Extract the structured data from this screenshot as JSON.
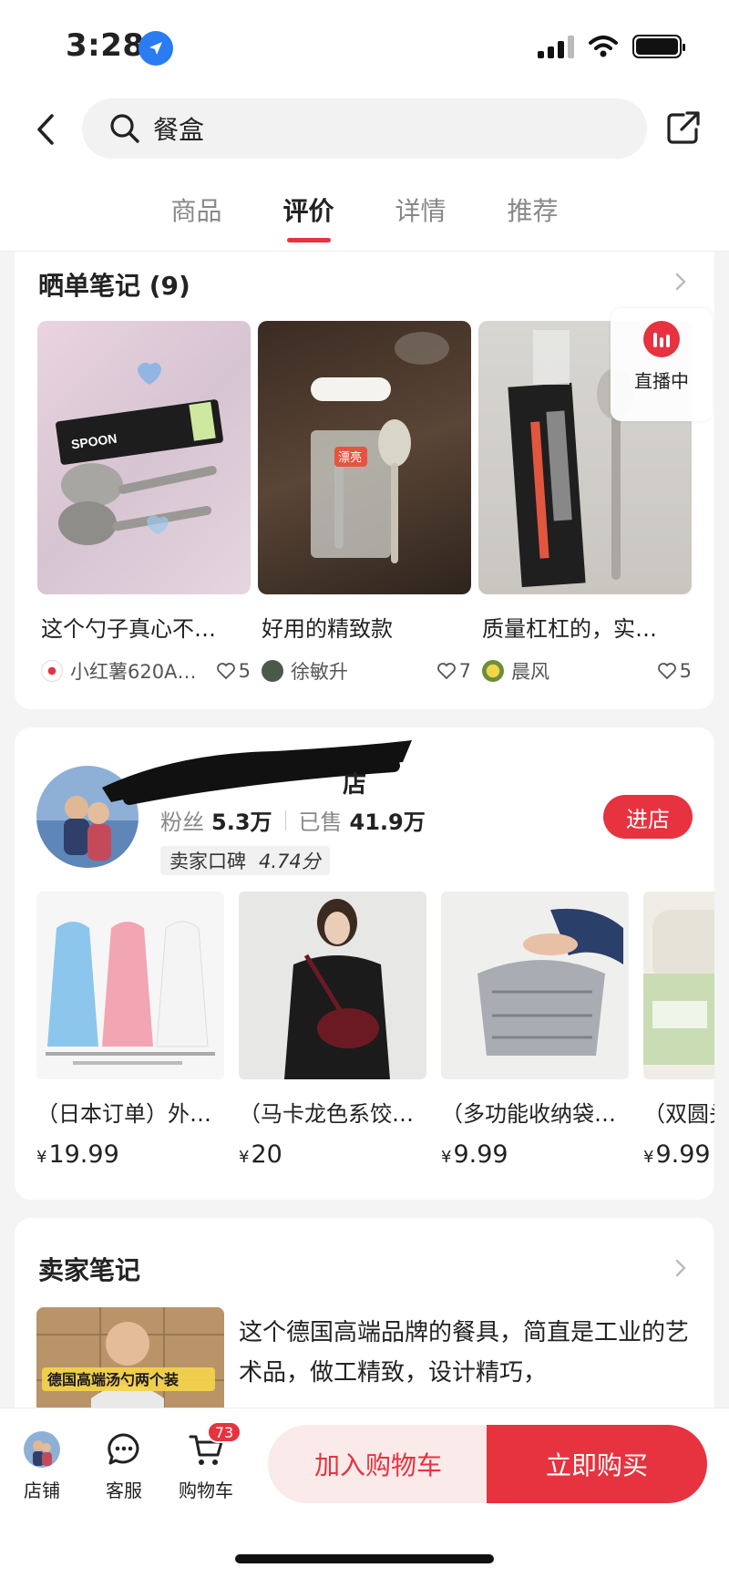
{
  "status_bar": {
    "time": "3:28"
  },
  "header": {
    "search_text": "餐盒",
    "tabs": [
      {
        "label": "商品",
        "active": false
      },
      {
        "label": "评价",
        "active": true
      },
      {
        "label": "详情",
        "active": false
      },
      {
        "label": "推荐",
        "active": false
      }
    ]
  },
  "notes": {
    "title": "晒单笔记 (9)",
    "live_label": "直播中",
    "items": [
      {
        "text": "这个勺子真心不…",
        "user": "小红薯620A…",
        "likes": "5"
      },
      {
        "text": "好用的精致款",
        "user": "徐敏升",
        "likes": "7"
      },
      {
        "text": "质量杠杠的，实…",
        "user": "晨风",
        "likes": "5"
      }
    ],
    "img_label_2": "漂亮",
    "spoon_pack_label": "SPOON"
  },
  "shop": {
    "name": "店",
    "fans_label": "粉丝",
    "fans_value": "5.3万",
    "sold_label": "已售",
    "sold_value": "41.9万",
    "rating_label": "卖家口碑",
    "rating_value": "4.74分",
    "enter_label": "进店",
    "products": [
      {
        "title": "（日本订单）外…",
        "price": "19.99"
      },
      {
        "title": "（马卡龙色系饺…",
        "price": "20"
      },
      {
        "title": "（多功能收纳袋…",
        "price": "9.99"
      },
      {
        "title": "（双圆头",
        "price": "9.99"
      }
    ],
    "currency": "¥"
  },
  "seller_notes": {
    "title": "卖家笔记",
    "text": "这个德国高端品牌的餐具，简直是工业的艺术品，做工精致，设计精巧，",
    "thumb_caption": "德国高端汤勺两个装"
  },
  "bottom_bar": {
    "shop_label": "店铺",
    "service_label": "客服",
    "cart_label": "购物车",
    "cart_count": "73",
    "add_cart_label": "加入购物车",
    "buy_now_label": "立即购买"
  },
  "colors": {
    "accent": "#e6333f",
    "location_blue": "#2b7bf3"
  }
}
